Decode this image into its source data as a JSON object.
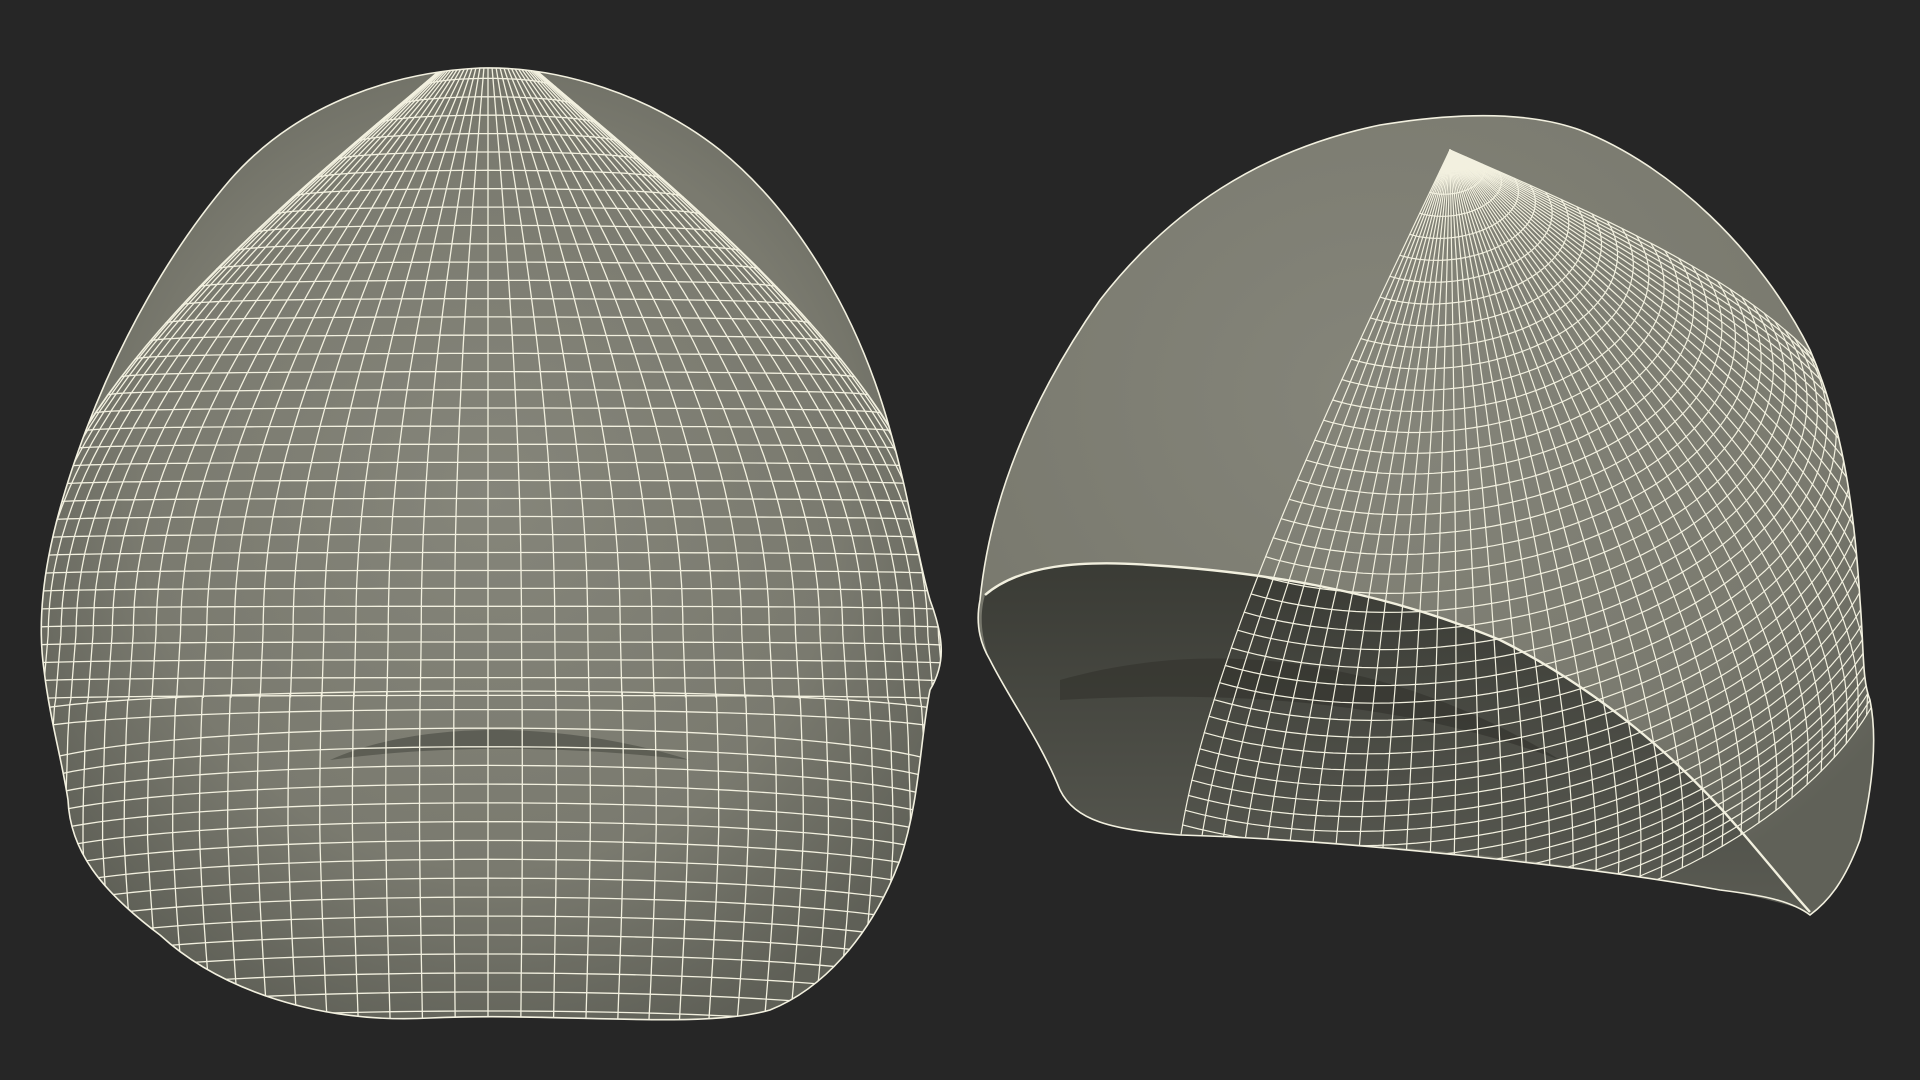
{
  "scene": {
    "background_color": "#262626",
    "surface_color": "#7e7e72",
    "surface_shadow_color": "#55564e",
    "interior_color": "#4a4b44",
    "interior_deep_color": "#34352f",
    "wire_color": "#f2f0df",
    "objects": [
      {
        "name": "helmet-front-view",
        "view": "front"
      },
      {
        "name": "helmet-three-quarter-view",
        "view": "three-quarter-underside"
      }
    ]
  }
}
